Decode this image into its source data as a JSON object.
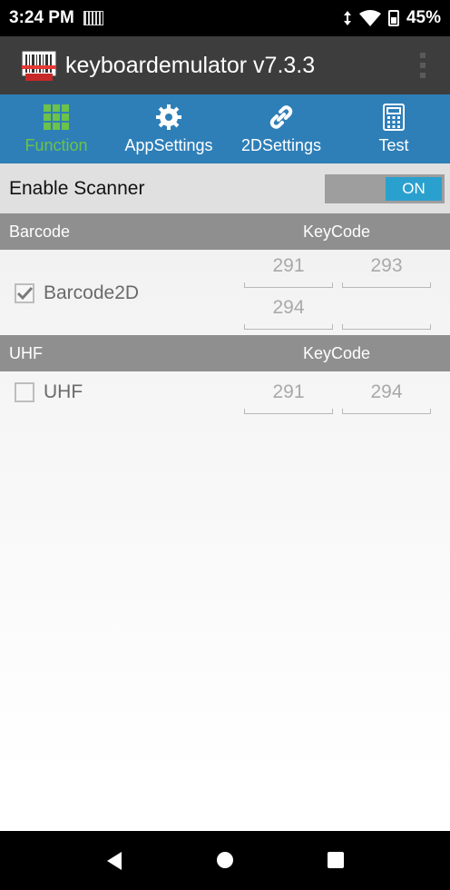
{
  "status_bar": {
    "time": "3:24 PM",
    "battery": "45%",
    "icons": [
      "barcode-notification-icon",
      "data-arrows-icon",
      "wifi-icon",
      "battery-icon"
    ]
  },
  "app_bar": {
    "title": "keyboardemulator v7.3.3",
    "logo_icon": "barcode-scanner-logo-icon",
    "menu_icon": "overflow-menu-icon"
  },
  "tabs": [
    {
      "label": "Function",
      "icon": "grid-icon",
      "active": true
    },
    {
      "label": "AppSettings",
      "icon": "gear-icon",
      "active": false
    },
    {
      "label": "2DSettings",
      "icon": "link-icon",
      "active": false
    },
    {
      "label": "Test",
      "icon": "calculator-icon",
      "active": false
    }
  ],
  "enable_scanner": {
    "label": "Enable Scanner",
    "toggle_state": "ON"
  },
  "barcode_section": {
    "header": "Barcode",
    "keycode_header": "KeyCode",
    "item": {
      "label": "Barcode2D",
      "checked": true
    },
    "keycodes": [
      "291",
      "293",
      "294",
      ""
    ]
  },
  "uhf_section": {
    "header": "UHF",
    "keycode_header": "KeyCode",
    "item": {
      "label": "UHF",
      "checked": false
    },
    "keycodes": [
      "291",
      "294"
    ]
  },
  "colors": {
    "tab_bar": "#2e7fb8",
    "active_tab": "#6cc24a",
    "toggle_on": "#2aa0cf",
    "app_bar": "#3d3d3d",
    "section_header": "#8f8f8f"
  },
  "nav_bar": {
    "icons": [
      "back-icon",
      "home-icon",
      "recents-icon"
    ]
  }
}
